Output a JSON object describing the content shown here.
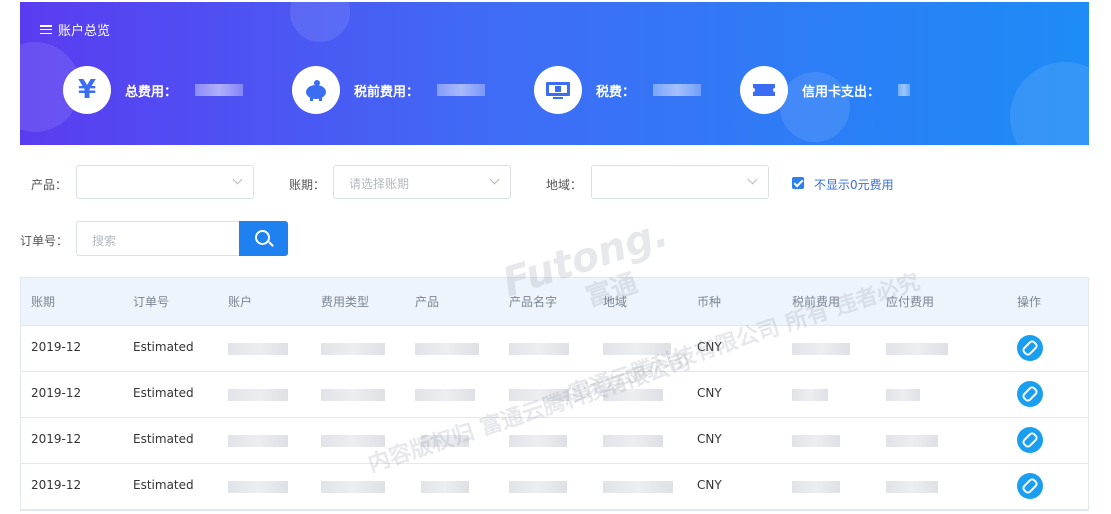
{
  "header": {
    "title": "账户总览",
    "stats": [
      {
        "icon": "yen-icon",
        "label": "总费用："
      },
      {
        "icon": "piggy-bank-icon",
        "label": "税前费用："
      },
      {
        "icon": "invoice-icon",
        "label": "税费："
      },
      {
        "icon": "credit-card-icon",
        "label": "信用卡支出："
      }
    ]
  },
  "filters": {
    "product_label": "产品：",
    "period_label": "账期：",
    "period_placeholder": "请选择账期",
    "region_label": "地域：",
    "hide_zero_label": "不显示0元费用",
    "hide_zero_checked": true,
    "order_label": "订单号：",
    "search_placeholder": "搜索"
  },
  "table": {
    "columns": [
      "账期",
      "订单号",
      "账户",
      "费用类型",
      "产品",
      "产品名字",
      "地域",
      "币种",
      "税前费用",
      "应付费用",
      "操作"
    ],
    "rows": [
      {
        "period": "2019-12",
        "order": "Estimated",
        "currency": "CNY"
      },
      {
        "period": "2019-12",
        "order": "Estimated",
        "currency": "CNY"
      },
      {
        "period": "2019-12",
        "order": "Estimated",
        "currency": "CNY"
      },
      {
        "period": "2019-12",
        "order": "Estimated",
        "currency": "CNY"
      }
    ]
  },
  "watermark": {
    "brand": "Futong.",
    "brand_cn": "富通",
    "line1": "富通云腾科技有限公司 所有 违者必究",
    "line2": "内容版权归 富通云腾科技有限公司"
  },
  "colors": {
    "banner_start": "#5a3cf0",
    "banner_end": "#1d8cf6",
    "accent": "#1f80f0",
    "action": "#1a9ff0"
  }
}
